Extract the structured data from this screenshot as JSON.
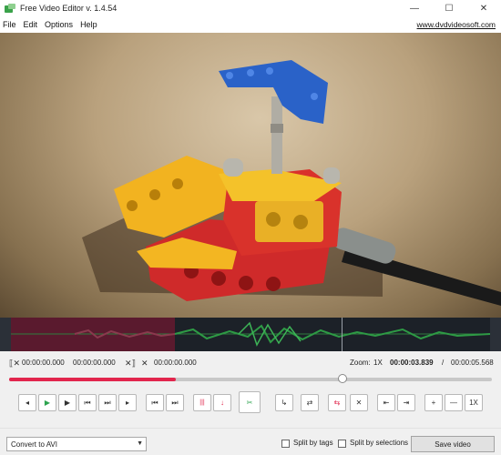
{
  "window": {
    "title": "Free Video Editor v. 1.4.54",
    "minimize_glyph": "—",
    "maximize_glyph": "☐",
    "close_glyph": "✕"
  },
  "menu": {
    "items": [
      "File",
      "Edit",
      "Options",
      "Help"
    ],
    "site_link": "www.dvdvideosoft.com"
  },
  "times": {
    "selection_start": "00:00:00.000",
    "selection_end": "00:00:00.000",
    "cut_start": "00:00:00.000",
    "zoom_label": "Zoom:",
    "zoom_value": "1X",
    "current": "00:00:03.839",
    "separator": "/",
    "total": "00:00:05.568"
  },
  "playback": {
    "progress_fraction": 0.345,
    "thumb_fraction": 0.69
  },
  "toolbar": {
    "zoom_reset_label": "1X",
    "buttons": [
      {
        "icon": "prev-frame-icon",
        "glyph": "◂"
      },
      {
        "icon": "play-icon",
        "glyph": "▶"
      },
      {
        "icon": "play-selection-icon",
        "glyph": "▶"
      },
      {
        "icon": "go-start-icon",
        "glyph": "⏮"
      },
      {
        "icon": "go-end-icon",
        "glyph": "⏭"
      },
      {
        "icon": "next-frame-icon",
        "glyph": "▸"
      },
      {
        "icon": "prev-cut-icon",
        "glyph": "⏮"
      },
      {
        "icon": "next-cut-icon",
        "glyph": "⏭"
      },
      {
        "icon": "mark-cut-icon",
        "glyph": "|||"
      },
      {
        "icon": "split-marker-icon",
        "glyph": "↓"
      },
      {
        "icon": "scissors-icon",
        "glyph": "✂"
      },
      {
        "icon": "rotate-icon",
        "glyph": "↳"
      },
      {
        "icon": "settings-sliders-icon",
        "glyph": "⇄"
      },
      {
        "icon": "copy-selection-icon",
        "glyph": "⇆"
      },
      {
        "icon": "delete-selection-icon",
        "glyph": "✕"
      },
      {
        "icon": "jump-prev-icon",
        "glyph": "⇤"
      },
      {
        "icon": "jump-next-icon",
        "glyph": "⇥"
      },
      {
        "icon": "zoom-in-icon",
        "glyph": "+"
      },
      {
        "icon": "zoom-out-icon",
        "glyph": "—"
      }
    ]
  },
  "footer": {
    "format": "Convert to AVI",
    "split_by_tags": "Split by tags",
    "split_by_selections": "Split by selections",
    "save_button": "Save video"
  },
  "colors": {
    "accent_red": "#e2264d",
    "waveform_green": "#2e7d3e",
    "selection_maroon": "#5a1a2e",
    "timeline_bg": "#1c2128"
  }
}
